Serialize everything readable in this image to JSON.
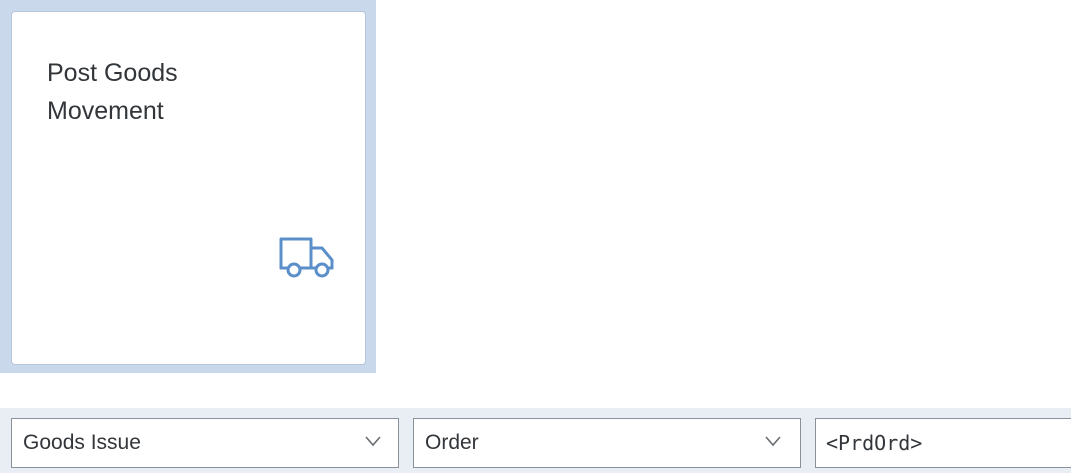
{
  "tile": {
    "title_line1": "Post Goods",
    "title_line2": "Movement",
    "icon": "truck-icon",
    "icon_color": "#5b8fc9"
  },
  "toolbar": {
    "movement_select": {
      "value": "Goods Issue",
      "icon": "chevron-down-icon"
    },
    "reference_select": {
      "value": "Order",
      "icon": "chevron-down-icon"
    },
    "order_field": {
      "value": "<PrdOrd>"
    }
  }
}
